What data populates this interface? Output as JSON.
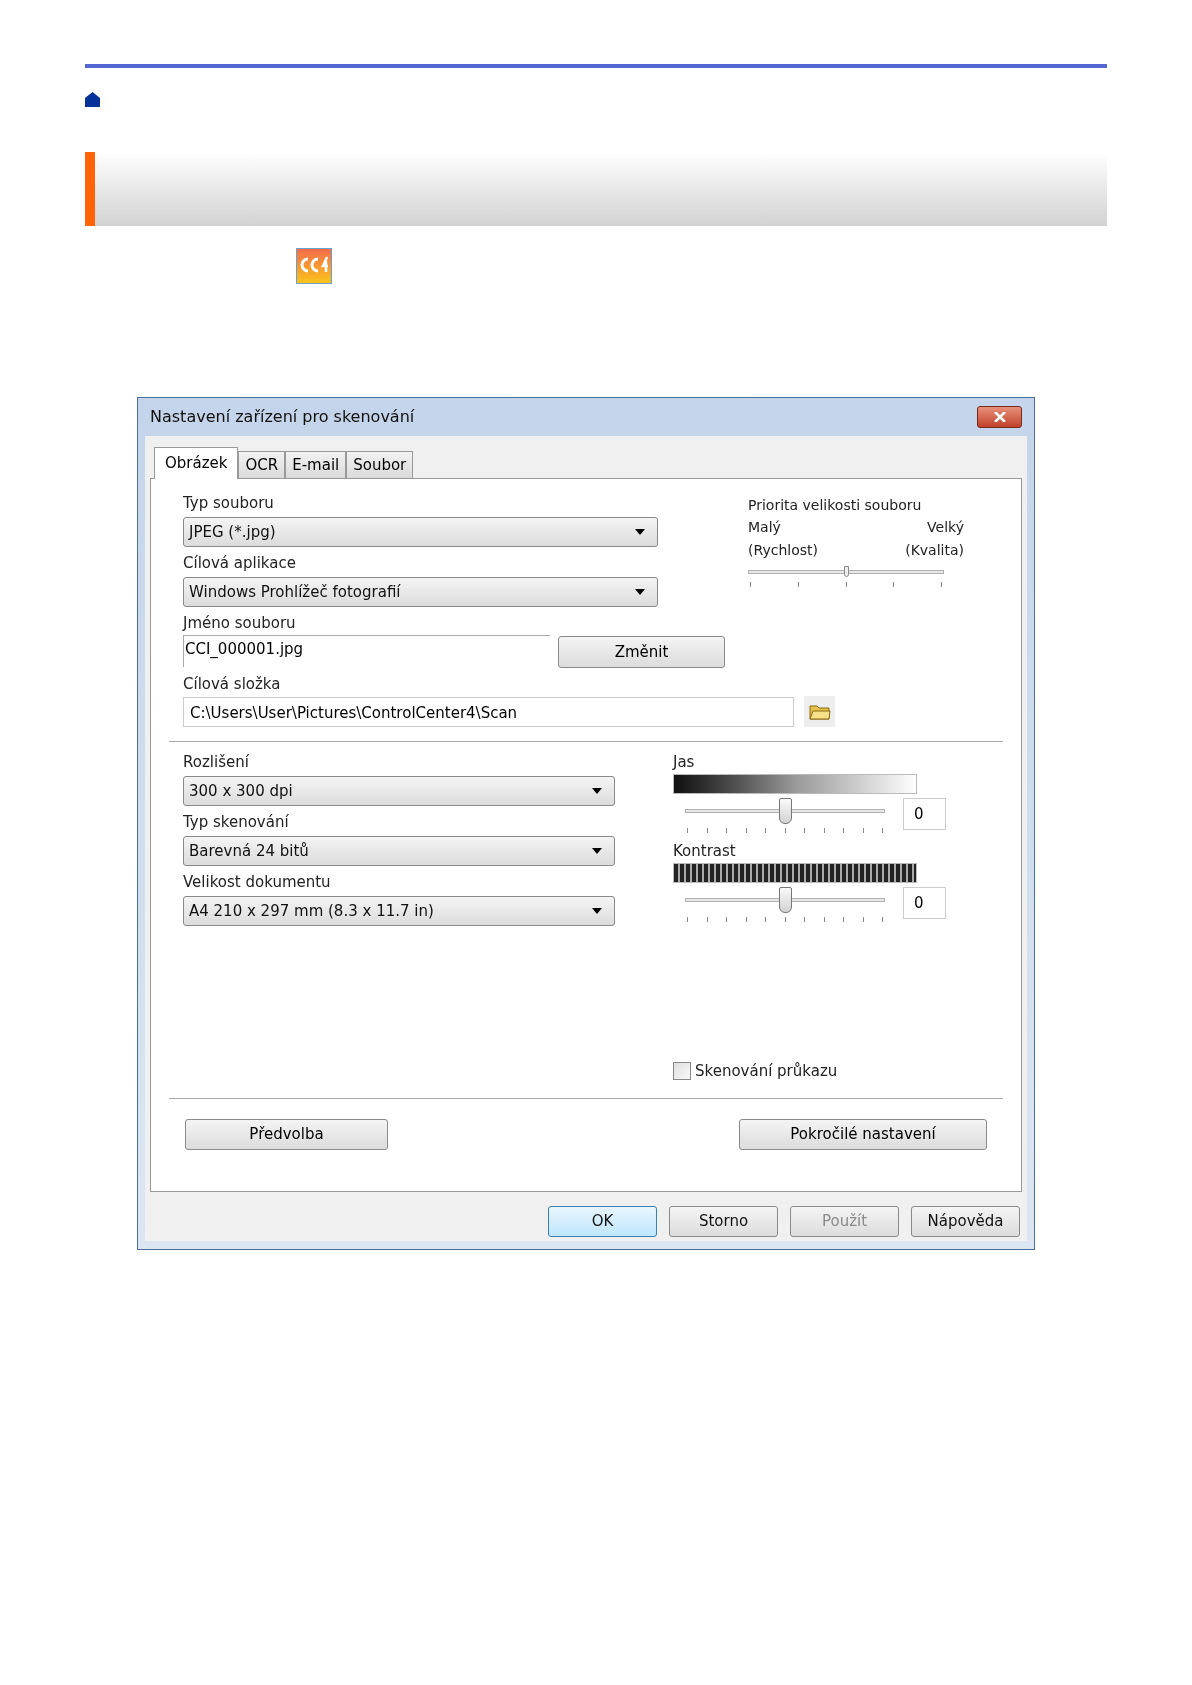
{
  "dialog": {
    "title": "Nastavení zařízení pro skenování",
    "tabs": [
      {
        "label": "Obrázek",
        "selected": true
      },
      {
        "label": "OCR",
        "selected": false
      },
      {
        "label": "E-mail",
        "selected": false
      },
      {
        "label": "Soubor",
        "selected": false
      }
    ],
    "file_type": {
      "label": "Typ souboru",
      "value": "JPEG (*.jpg)"
    },
    "target_app": {
      "label": "Cílová aplikace",
      "value": "Windows Prohlížeč fotografií"
    },
    "file_name": {
      "label": "Jméno souboru",
      "value": "CCI_000001.jpg",
      "button": "Změnit"
    },
    "target_folder": {
      "label": "Cílová složka",
      "value": "C:\\Users\\User\\Pictures\\ControlCenter4\\Scan"
    },
    "file_size_priority": {
      "label": "Priorita velikosti souboru",
      "min_label": "Malý",
      "max_label": "Velký",
      "min_note": "(Rychlost)",
      "max_note": "(Kvalita)",
      "level": 0.5
    },
    "resolution": {
      "label": "Rozlišení",
      "value": "300 x 300 dpi"
    },
    "scan_type": {
      "label": "Typ skenování",
      "value": "Barevná 24 bitů"
    },
    "document_size": {
      "label": "Velikost dokumentu",
      "value": "A4 210 x 297 mm (8.3 x 11.7 in)"
    },
    "brightness": {
      "label": "Jas",
      "level": 0.5,
      "value": "0"
    },
    "contrast": {
      "label": "Kontrast",
      "level": 0.5,
      "value": "0"
    },
    "id_card_scan": {
      "label": "Skenování průkazu",
      "checked": false
    },
    "preset_button": "Předvolba",
    "advanced_button": "Pokročilé nastavení",
    "buttons": [
      {
        "label": "OK",
        "default": true,
        "disabled": false
      },
      {
        "label": "Storno",
        "default": false,
        "disabled": false
      },
      {
        "label": "Použít",
        "default": false,
        "disabled": true
      },
      {
        "label": "Nápověda",
        "default": false,
        "disabled": false
      }
    ]
  }
}
